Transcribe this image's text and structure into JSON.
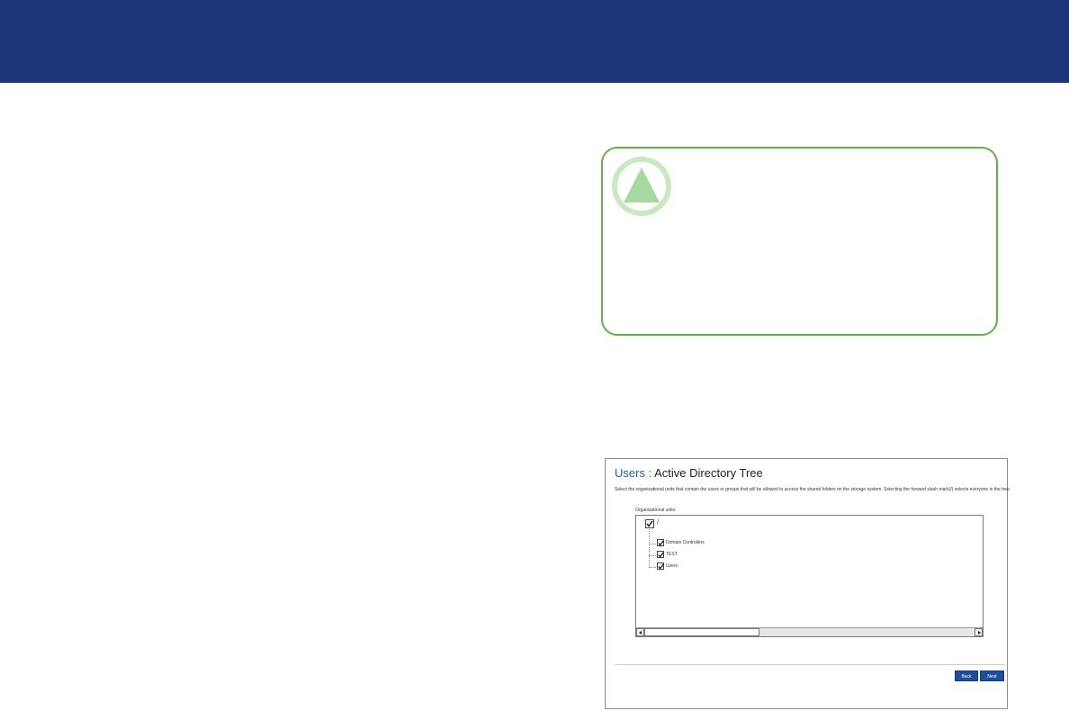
{
  "colors": {
    "banner": "#1b3678",
    "callout_border": "#5fb34a",
    "callout_icon_ring": "#cbe8c4",
    "callout_icon_triangle": "#a8d9a0",
    "button": "#1e4d9e",
    "title_accent": "#2a5c9a"
  },
  "callout": {
    "icon": "warning-triangle-icon"
  },
  "screenshot": {
    "title_primary": "Users",
    "title_separator": ":",
    "title_secondary": "Active Directory Tree",
    "description": "Select the organizational units that contain the users or groups that will be allowed to access the shared folders on the storage system. Selecting the forward slash mark(/) selects everyone in the tree.",
    "ou_label": "Organizational units:",
    "tree": {
      "root": {
        "label": "/",
        "checked": true
      },
      "children": [
        {
          "label": "Domain Controllers",
          "checked": true
        },
        {
          "label": "TEST",
          "checked": true
        },
        {
          "label": "Users",
          "checked": true
        }
      ]
    },
    "buttons": {
      "back": "Back",
      "next": "Next"
    }
  }
}
